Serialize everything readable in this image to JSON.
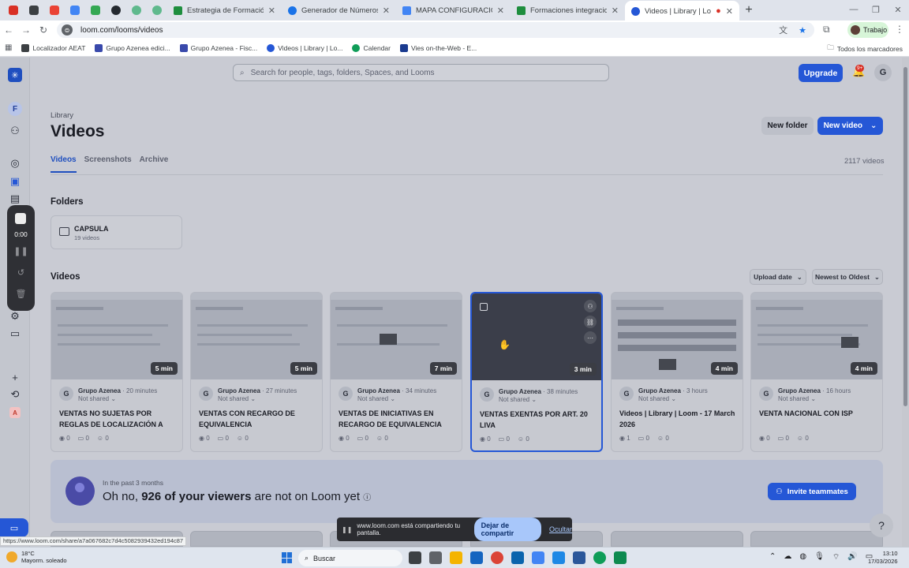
{
  "browser": {
    "tabs": [
      {
        "title": "Estrategia de Formación AZENE",
        "color": "#1e8e3e",
        "active": false
      },
      {
        "title": "Generador de Números de DNI",
        "color": "#1a73e8",
        "active": false
      },
      {
        "title": "MAPA CONFIGURACION EXCEL",
        "color": "#4285f4",
        "active": false
      },
      {
        "title": "Formaciones integraciones - H",
        "color": "#1e8e3e",
        "active": false
      },
      {
        "title": "Videos | Library | Loom",
        "color": "#2557d6",
        "active": true
      }
    ],
    "url": "loom.com/looms/videos",
    "profile_label": "Trabajo",
    "bookmarks": [
      "Localizador AEAT",
      "Grupo Azenea edici...",
      "Grupo Azenea - Fisc...",
      "Videos | Library | Lo...",
      "Calendar",
      "Vies on-the-Web - E..."
    ],
    "all_bookmarks": "Todos los marcadores",
    "status_url": "https://www.loom.com/share/a7a067682c7d4c5082939432ed194c87"
  },
  "loom": {
    "search_placeholder": "Search for people, tags, folders, Spaces, and Looms",
    "upgrade": "Upgrade",
    "notif_badge": "9+",
    "user_initial": "G",
    "workspace_initial": "F",
    "recorder_time": "0:00",
    "breadcrumb": "Library",
    "title": "Videos",
    "new_folder": "New folder",
    "new_video": "New video",
    "tabs": [
      "Videos",
      "Screenshots",
      "Archive"
    ],
    "video_count": "2117 videos",
    "folders_heading": "Folders",
    "folder": {
      "name": "CAPSULA",
      "count": "19 videos"
    },
    "videos_heading": "Videos",
    "sort_upload": "Upload date",
    "sort_order": "Newest to Oldest",
    "videos": [
      {
        "duration": "5 min",
        "owner": "Grupo Azenea",
        "time": "· 20 minutes",
        "share": "Not shared",
        "title": "VENTAS NO SUJETAS POR REGLAS DE LOCALIZACIÓN A CLIENTE...",
        "views": "0",
        "comments": "0",
        "reactions": "0"
      },
      {
        "duration": "5 min",
        "owner": "Grupo Azenea",
        "time": "· 27 minutes",
        "share": "Not shared",
        "title": "VENTAS CON RECARGO DE EQUIVALENCIA",
        "views": "0",
        "comments": "0",
        "reactions": "0"
      },
      {
        "duration": "7 min",
        "owner": "Grupo Azenea",
        "time": "· 34 minutes",
        "share": "Not shared",
        "title": "VENTAS DE INICIATIVAS EN RECARGO DE EQUIVALENCIA",
        "views": "0",
        "comments": "0",
        "reactions": "0"
      },
      {
        "duration": "3 min",
        "owner": "Grupo Azenea",
        "time": "· 38 minutes",
        "share": "Not shared",
        "title": "VENTAS EXENTAS POR ART. 20 LIVA",
        "views": "0",
        "comments": "0",
        "reactions": "0"
      },
      {
        "duration": "4 min",
        "owner": "Grupo Azenea",
        "time": "· 3 hours",
        "share": "Not shared",
        "title": "Videos | Library | Loom - 17 March 2026",
        "views": "1",
        "comments": "0",
        "reactions": "0"
      },
      {
        "duration": "4 min",
        "owner": "Grupo Azenea",
        "time": "· 16 hours",
        "share": "Not shared",
        "title": "VENTA NACIONAL CON ISP",
        "views": "0",
        "comments": "0",
        "reactions": "0"
      }
    ],
    "banner": {
      "sub": "In the past 3 months",
      "pre": "Oh no, ",
      "strong": "926 of your viewers",
      "post": " are not on Loom yet",
      "invite": "Invite teammates"
    },
    "share_bar": {
      "text": "www.loom.com está compartiendo tu pantalla.",
      "stop": "Dejar de compartir",
      "hide": "Ocultar"
    }
  },
  "taskbar": {
    "temp": "18°C",
    "weather": "Mayorm. soleado",
    "search": "Buscar",
    "time": "13:10",
    "date": "17/03/2026"
  }
}
